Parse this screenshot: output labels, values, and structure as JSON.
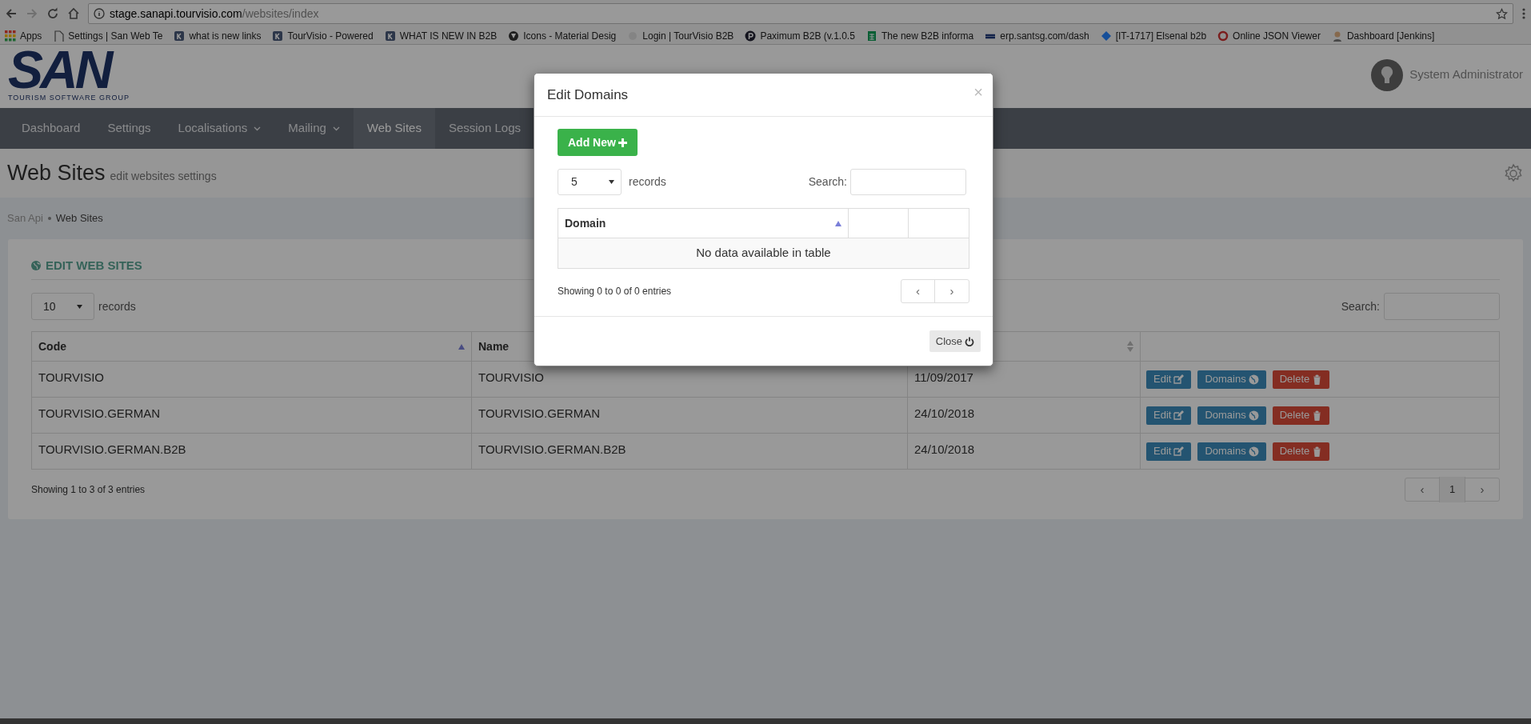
{
  "browser": {
    "url_host": "stage.sanapi.tourvisio.com",
    "url_path": "/websites/index",
    "bookmarks": [
      {
        "label": "Apps",
        "kind": "apps"
      },
      {
        "label": "Settings | San Web Te",
        "kind": "page"
      },
      {
        "label": "what is new links",
        "kind": "k"
      },
      {
        "label": "TourVisio - Powered",
        "kind": "k"
      },
      {
        "label": "WHAT IS NEW IN B2B",
        "kind": "k"
      },
      {
        "label": "Icons - Material Desig",
        "kind": "circle"
      },
      {
        "label": "Login | TourVisio B2B",
        "kind": "blank"
      },
      {
        "label": "Paximum B2B (v.1.0.5",
        "kind": "p"
      },
      {
        "label": "The new B2B informa",
        "kind": "sheet"
      },
      {
        "label": "erp.santsg.com/dash",
        "kind": "san"
      },
      {
        "label": "[IT-1717] Elsenal b2b",
        "kind": "diamond"
      },
      {
        "label": "Online JSON Viewer",
        "kind": "ring"
      },
      {
        "label": "Dashboard [Jenkins]",
        "kind": "person"
      }
    ]
  },
  "logo": {
    "wordmark": "SAN",
    "tagline": "TOURISM SOFTWARE GROUP"
  },
  "user": {
    "name": "System Administrator"
  },
  "nav": [
    {
      "label": "Dashboard",
      "selected": false,
      "dropdown": false
    },
    {
      "label": "Settings",
      "selected": false,
      "dropdown": false
    },
    {
      "label": "Localisations",
      "selected": false,
      "dropdown": true
    },
    {
      "label": "Mailing",
      "selected": false,
      "dropdown": true
    },
    {
      "label": "Web Sites",
      "selected": true,
      "dropdown": false
    },
    {
      "label": "Session Logs",
      "selected": false,
      "dropdown": false
    }
  ],
  "page_header": {
    "title": "Web Sites",
    "subtitle": "edit websites settings"
  },
  "breadcrumbs": [
    "San Api",
    "Web Sites"
  ],
  "panel": {
    "title": "EDIT WEB SITES",
    "page_size": "10",
    "records_label": "records",
    "search_label": "Search:",
    "columns": [
      {
        "label": "Code",
        "kind": "sorted"
      },
      {
        "label": "Name",
        "kind": "plain"
      },
      {
        "kind": "sortable"
      },
      {
        "kind": "plain"
      }
    ],
    "rows": [
      {
        "code": "TOURVISIO",
        "name": "TOURVISIO",
        "date": "11/09/2017",
        "actions": [
          {
            "label": "Edit",
            "kind": "edit"
          },
          {
            "label": "Domains",
            "kind": "domains"
          },
          {
            "label": "Delete",
            "kind": "delete"
          }
        ]
      },
      {
        "code": "TOURVISIO.GERMAN",
        "name": "TOURVISIO.GERMAN",
        "date": "24/10/2018",
        "actions": [
          {
            "label": "Edit",
            "kind": "edit"
          },
          {
            "label": "Domains",
            "kind": "domains"
          },
          {
            "label": "Delete",
            "kind": "delete"
          }
        ]
      },
      {
        "code": "TOURVISIO.GERMAN.B2B",
        "name": "TOURVISIO.GERMAN.B2B",
        "date": "24/10/2018",
        "actions": [
          {
            "label": "Edit",
            "kind": "edit"
          },
          {
            "label": "Domains",
            "kind": "domains"
          },
          {
            "label": "Delete",
            "kind": "delete"
          }
        ]
      }
    ],
    "info": "Showing 1 to 3 of 3 entries",
    "pagination": {
      "prev": "‹",
      "pages": [
        {
          "label": "1",
          "selected": true
        }
      ],
      "next": "›"
    }
  },
  "modal": {
    "title": "Edit Domains",
    "close_symbol": "×",
    "add_button": "Add New",
    "page_size": "5",
    "records_label": "records",
    "search_label": "Search:",
    "columns": [
      {
        "label": "Domain",
        "kind": "sorted"
      },
      {
        "kind": "plain"
      },
      {
        "kind": "plain"
      }
    ],
    "empty_message": "No data available in table",
    "info": "Showing 0 to 0 of 0 entries",
    "pagination": {
      "prev": "‹",
      "next": "›"
    },
    "close_button": "Close"
  }
}
